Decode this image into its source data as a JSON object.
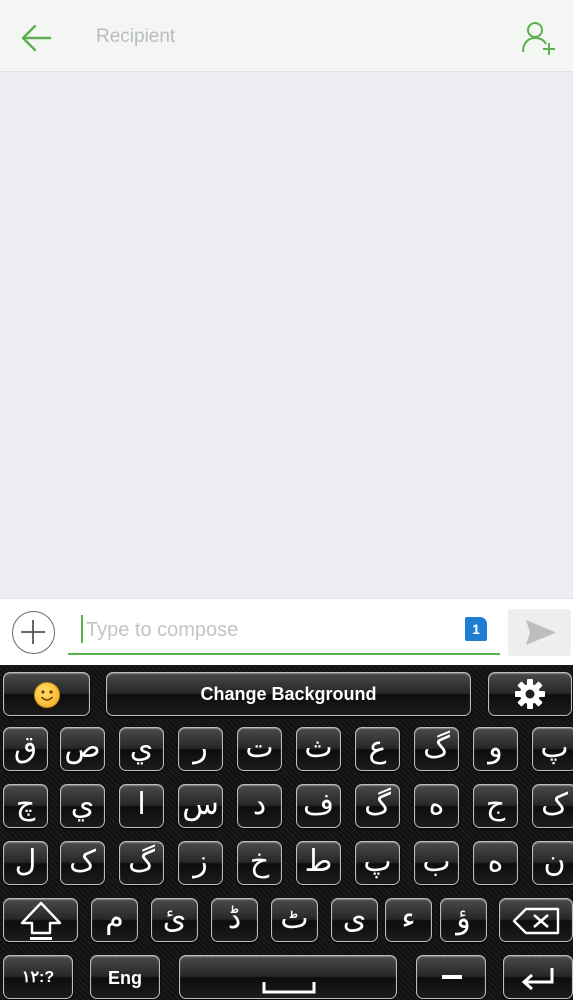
{
  "header": {
    "recipient_placeholder": "Recipient",
    "accent_color": "#5cb04f"
  },
  "compose": {
    "placeholder": "Type to compose",
    "sim_badge": "1"
  },
  "keyboard": {
    "toolbar": {
      "emoji_icon": "smiley-icon",
      "change_background_label": "Change Background",
      "settings_icon": "gear-icon"
    },
    "rows": [
      [
        "ق",
        "ص",
        "ي",
        "ر",
        "ت",
        "ث",
        "ع",
        "گ",
        "و",
        "پ"
      ],
      [
        "چ",
        "ي",
        "ا",
        "س",
        "د",
        "ف",
        "گ",
        "ه",
        "ج",
        "ک"
      ],
      [
        "ل",
        "ک",
        "گ",
        "ز",
        "خ",
        "ط",
        "پ",
        "ب",
        "ه",
        "ن"
      ],
      [
        "م",
        "ئ",
        "ڈ",
        "ٹ",
        "ی",
        "ء",
        "ؤ"
      ]
    ],
    "symbols_label": "۱۲:?",
    "language_label": "Eng"
  }
}
